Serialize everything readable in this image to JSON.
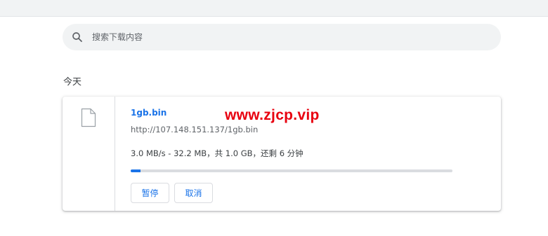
{
  "search": {
    "placeholder": "搜索下载内容",
    "value": ""
  },
  "section": {
    "title": "今天"
  },
  "download": {
    "file_name": "1gb.bin",
    "url": "http://107.148.151.137/1gb.bin",
    "status": "3.0 MB/s - 32.2 MB，共 1.0 GB，还剩 6 分钟",
    "progress_fraction": 0.03,
    "pause_label": "暂停",
    "cancel_label": "取消"
  },
  "watermark": "www.zjcp.vip",
  "icons": {
    "search": "search-icon",
    "file": "file-icon"
  },
  "colors": {
    "accent": "#1a73e8",
    "watermark": "#e8000f",
    "search_bg": "#f1f3f4"
  }
}
